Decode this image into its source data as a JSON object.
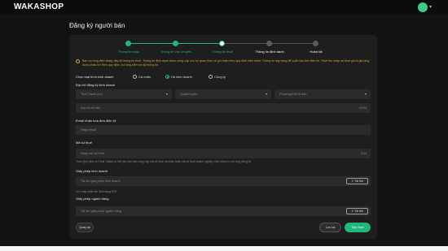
{
  "header": {
    "brand": "WAKASHOP"
  },
  "page": {
    "title": "Đăng ký người bán"
  },
  "steps": [
    {
      "label": "Thông tin shop",
      "state": "done"
    },
    {
      "label": "Thông tin vận chuyển",
      "state": "done"
    },
    {
      "label": "Thông tin thuế",
      "state": "current"
    },
    {
      "label": "Thông tin định danh",
      "state": "upcoming"
    },
    {
      "label": "Hoàn tất",
      "state": "upcoming"
    }
  ],
  "notice": {
    "text": "Bạn vui lòng điền đúng, đầy đủ thông tin thuế. Thông tin định danh được cung cấp cho cơ quan thuế và ghi nhận theo quy định hiện hành. Thông tin này dùng để xuất hóa đơn điện tử. Thuế thu nhập và thuế giá trị gia tăng được khấu trừ theo quy định, vui lòng kiểm tra kỹ thông tin."
  },
  "form": {
    "business_type_label": "Chọn loại hình kinh doanh",
    "business_types": [
      "Cá nhân",
      "Hộ kinh doanh",
      "Công ty"
    ],
    "selected_type": "Hộ kinh doanh",
    "address_label": "Địa chỉ đăng ký kinh doanh",
    "province_placeholder": "Tỉnh/Thành phố",
    "district_placeholder": "Quận/Huyện",
    "ward_placeholder": "Phường/Xã/Thị trấn",
    "street_placeholder": "Địa chỉ chi tiết",
    "street_counter": "0/200",
    "email_label": "Email nhận hóa đơn điện tử",
    "email_placeholder": "Nhập email",
    "tax_label": "Mã số thuế",
    "tax_placeholder": "Nhập mã số thuế",
    "tax_counter": "0/14",
    "tax_hint": "Theo Quy định về Thuế, Waka có thể yêu cầu bạn cung cấp mã số thuế cá nhân hoặc mã số thuế doanh nghiệp. Nếu chưa có vui lòng đăng ký.",
    "license_label": "Giấy phép kinh doanh",
    "license_placeholder": "Tải lên giấy phép kinh doanh",
    "license_hint": "Chỉ chấp nhận file định dạng PDF",
    "food_license_label": "Giấy phép ngành hàng",
    "food_license_placeholder": "Tải lên giấy phép ngành hàng",
    "upload_label": "Tải lên"
  },
  "actions": {
    "back": "Quay lại",
    "save": "Lưu lại",
    "next": "Tiếp theo"
  }
}
